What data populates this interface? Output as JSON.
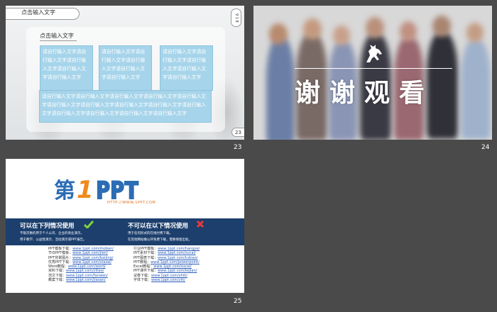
{
  "slides": [
    {
      "number": "23",
      "title": "点击输入文字",
      "side_tag": "9 1 8",
      "panel_title": "点击输入文字",
      "boxes": [
        "请自行输入文字请自行输入文字请自行输入文字请自行输入文字请自行输入文字",
        "请自行输入文字请自行输入文字请自行输入文字请自行输入文字请自行输入文字",
        "请自行输入文字请自行输入文字请自行输入文字请自行输入文字请自行输入文字",
        "请自行输入文字请自行输入文字请自行输入文字请自行输入文字请自行输入文字请自行输入文字请自行输入文字请自行输入文字请自行输入文字请自行输入文字请自行输入文字请自行输入文字请自行输入文字请自行输入文字"
      ],
      "page_badge": "23"
    },
    {
      "number": "24",
      "heading": "谢谢观看",
      "icon": "horse-logo-icon"
    },
    {
      "number": "25",
      "logo_text": "第1PPT",
      "logo_url": "HTTP://WWW.1PPT.COM",
      "can_use_title": "可以在下列情况使用",
      "can_use_lines": [
        "不限次数的用于个人公司、企业的商业演示。",
        "用于教学、公益性演示、活动演示或PPT报告。"
      ],
      "cannot_use_title": "不可以在以下情况使用",
      "cannot_use_lines": [
        "用于任何形式的在线付费下载。",
        "在其他网站做公开免费下载，需要保留出处。"
      ],
      "links_left": [
        {
          "label": "PPT模板下载：",
          "url": "www.1ppt.com/moban/"
        },
        {
          "label": "节日PPT模板：",
          "url": "www.1ppt.com/jieri/"
        },
        {
          "label": "PPT背景图片：",
          "url": "www.1ppt.com/beijing/"
        },
        {
          "label": "优秀PPT下载：",
          "url": "www.1ppt.com/xiazai/"
        },
        {
          "label": "Word教程：",
          "url": "www.1ppt.com/word/"
        },
        {
          "label": "资料下载：",
          "url": "www.1ppt.com/ziliao/"
        },
        {
          "label": "范文下载：",
          "url": "www.1ppt.com/fanwen/"
        },
        {
          "label": "教案下载：",
          "url": "www.1ppt.com/jiaoan/"
        }
      ],
      "links_right": [
        {
          "label": "行业PPT模板：",
          "url": "www.1ppt.com/hangye/"
        },
        {
          "label": "PPT素材下载：",
          "url": "www.1ppt.com/sucai/"
        },
        {
          "label": "PPT图表下载：",
          "url": "www.1ppt.com/tubiao/"
        },
        {
          "label": "PPT教程：",
          "url": "www.1ppt.com/powerpoint/"
        },
        {
          "label": "Excel教程：",
          "url": "www.1ppt.com/excel/"
        },
        {
          "label": "PPT课件下载：",
          "url": "www.1ppt.com/kejian/"
        },
        {
          "label": "试卷下载：",
          "url": "www.1ppt.com/shiti/"
        },
        {
          "label": "字体下载：",
          "url": "www.1ppt.com/ziti/"
        }
      ]
    }
  ],
  "colors": {
    "background": "#4a4a4a",
    "box_blue": "#a6d4ea",
    "banner_navy": "#1c3f6d",
    "logo_blue": "#2b6cb4",
    "logo_orange": "#f08a1c"
  }
}
